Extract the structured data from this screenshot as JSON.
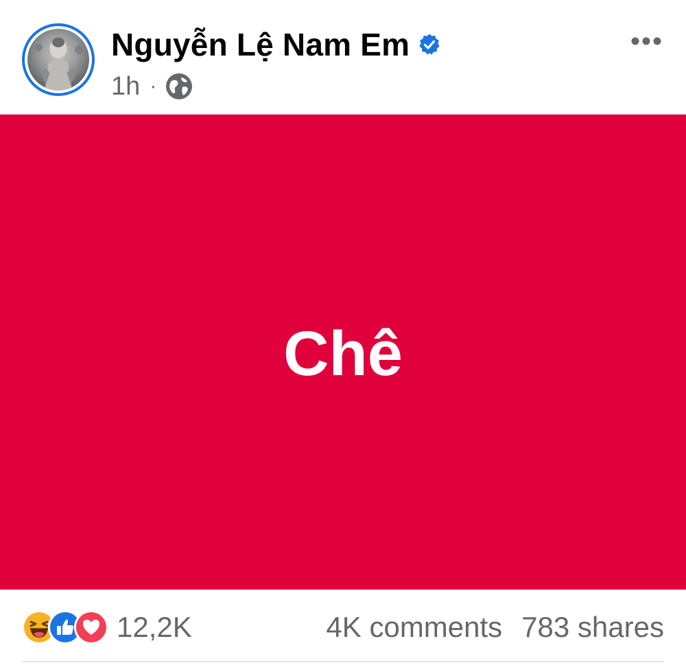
{
  "post": {
    "author_name": "Nguyễn Lệ Nam Em",
    "verified": true,
    "time": "1h",
    "separator": "·",
    "audience_icon": "globe-icon",
    "more_icon": "more-horizontal-icon",
    "image_text": "Chê",
    "image_background": "#e0003b"
  },
  "stats": {
    "reaction_icons": [
      "haha-icon",
      "like-icon",
      "love-icon"
    ],
    "reaction_count": "12,2K",
    "comments": "4K comments",
    "shares": "783 shares"
  },
  "colors": {
    "accent": "#1b74e4",
    "secondary_text": "#65676b",
    "primary_text": "#050505"
  }
}
